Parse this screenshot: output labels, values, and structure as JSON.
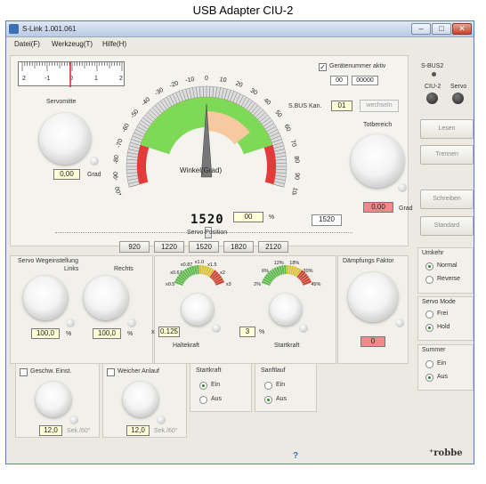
{
  "caption": "USB Adapter CIU-2",
  "window": {
    "title": "S-Link 1.001.061"
  },
  "menu": {
    "file": "Datei(F)",
    "tools": "Werkzeug(T)",
    "help": "Hilfe(H)"
  },
  "ruler": {
    "ticks": [
      "2",
      "-1",
      "0",
      "1",
      "2"
    ]
  },
  "servomitte": {
    "label": "Servomitte",
    "value": "0,00",
    "unit": "Grad"
  },
  "gauge": {
    "ticks": [
      "-100",
      "-90",
      "-80",
      "-70",
      "-60",
      "-50",
      "-40",
      "-30",
      "-20",
      "-10",
      "0",
      "10",
      "20",
      "30",
      "40",
      "50",
      "60",
      "70",
      "80",
      "90",
      "100"
    ],
    "label": "Winkel(Grad)",
    "angle": 0
  },
  "position": {
    "display": "1520",
    "percent": "00",
    "percent_unit": "%",
    "spin_value": "1520",
    "label": "Servo Position"
  },
  "presets": [
    "920",
    "1220",
    "1520",
    "1820",
    "2120"
  ],
  "geraet": {
    "label": "Gerätenummer aktiv",
    "field1": "00",
    "field2": "00000",
    "checked": true
  },
  "sbus_kan": {
    "label": "S.BUS Kan.",
    "value": "01",
    "button": "wechseln"
  },
  "sbus2": {
    "label": "S-BUS2",
    "ciu_label": "CIU-2",
    "servo_label": "Servo"
  },
  "totbereich": {
    "label": "Totbereich",
    "value": "0,00",
    "unit": "Grad"
  },
  "buttons": {
    "lesen": "Lesen",
    "trennen": "Trennen",
    "schreiben": "Schreiben",
    "standard": "Standard"
  },
  "wegeinstellung": {
    "title": "Servo Wegeinstellung",
    "links": "Links",
    "rechts": "Rechts",
    "links_value": "100,0",
    "rechts_value": "100,0",
    "unit": "%"
  },
  "haltekraft": {
    "ticks": [
      "x0.5",
      "x0.67",
      "x0.87",
      "x1.0",
      "x1.5",
      "x2",
      "x3"
    ],
    "prefix": "x",
    "value": "0.125",
    "label": "Haltekraft"
  },
  "startkraft": {
    "ticks": [
      "2%",
      "6%",
      "12%",
      "18%",
      "30%",
      "45%"
    ],
    "value": "3",
    "unit": "%",
    "label": "Startkraft"
  },
  "daempfung": {
    "label": "Dämpfungs Faktor",
    "value": "0"
  },
  "umkehr": {
    "title": "Umkehr",
    "options": [
      "Normal",
      "Reverse"
    ],
    "selected": 0
  },
  "servo_mode": {
    "title": "Servo Mode",
    "options": [
      "Frei",
      "Hold"
    ],
    "selected": 1
  },
  "summer": {
    "title": "Summer",
    "options": [
      "Ein",
      "Aus"
    ],
    "selected": 1
  },
  "geschw": {
    "label": "Geschw. Einst.",
    "value": "12,0",
    "unit": "Sek./60°"
  },
  "weicher": {
    "label": "Weicher Anlauf",
    "value": "12,0",
    "unit": "Sek./60°"
  },
  "startkraft_group": {
    "title": "Startkraft",
    "options": [
      "Ein",
      "Aus"
    ],
    "selected": 0
  },
  "sanftlauf": {
    "title": "Sanftlauf",
    "options": [
      "Ein",
      "Aus"
    ],
    "selected": 1
  },
  "footer": {
    "help": "?",
    "brand": "robbe"
  },
  "colors": {
    "green": "#7ed957",
    "red": "#e23b3b",
    "peach": "#f7c9a0"
  }
}
